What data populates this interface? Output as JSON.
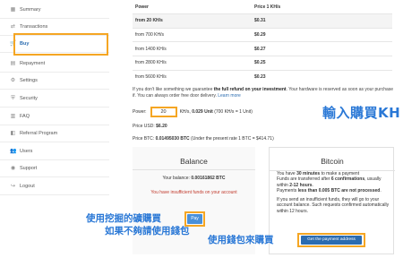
{
  "sidebar": {
    "items": [
      {
        "label": "Summary",
        "icon": "summary-icon",
        "glyph": "▦"
      },
      {
        "label": "Transactions",
        "icon": "transactions-icon",
        "glyph": "⇄"
      },
      {
        "label": "Buy",
        "icon": "cart-icon",
        "glyph": "🛒"
      },
      {
        "label": "Repayment",
        "icon": "repayment-icon",
        "glyph": "▤"
      },
      {
        "label": "Settings",
        "icon": "gear-icon",
        "glyph": "⚙"
      },
      {
        "label": "Security",
        "icon": "shield-icon",
        "glyph": "⛨"
      },
      {
        "label": "FAQ",
        "icon": "book-icon",
        "glyph": "▥"
      },
      {
        "label": "Referral Program",
        "icon": "referral-icon",
        "glyph": "◧"
      },
      {
        "label": "Users",
        "icon": "users-icon",
        "glyph": "👥"
      },
      {
        "label": "Support",
        "icon": "support-icon",
        "glyph": "◉"
      },
      {
        "label": "Logout",
        "icon": "logout-icon",
        "glyph": "↪"
      }
    ],
    "active": "Buy"
  },
  "price_table": {
    "col_power": "Power",
    "col_price": "Price 1 KH/s",
    "rows": [
      {
        "power": "from 20 KH/s",
        "price": "$0.31"
      },
      {
        "power": "from 700 KH/s",
        "price": "$0.29"
      },
      {
        "power": "from 1400 KH/s",
        "price": "$0.27"
      },
      {
        "power": "from 2800 KH/s",
        "price": "$0.25"
      },
      {
        "power": "from 5600 KH/s",
        "price": "$0.23"
      }
    ]
  },
  "note": {
    "pre": "If you don't like something we guarantee ",
    "bold": "the full refund on your investment",
    "post": ". Your hardware is reserved as soon as your purchase if. You can always order free door delivery. ",
    "link": "Learn more"
  },
  "power": {
    "label": "Power:",
    "value": "20",
    "unit": "KH/s,",
    "units": "0.029 Unit",
    "units_note": "(700 KH/s = 1 Unit)"
  },
  "usd": {
    "label": "Price USD:",
    "value": "$6.20"
  },
  "btc": {
    "label": "Price BTC:",
    "value": "0.01495030 BTC",
    "note": "(Under the present rate 1 BTC = $414.71)"
  },
  "annotations": {
    "big": "輸入購買KH",
    "pay_line1": "使用挖掘的礦購買",
    "pay_line2": "如果不夠請使用錢包",
    "wallet": "使用錢包來購買"
  },
  "balance_panel": {
    "title": "Balance",
    "balance_label": "Your balance:",
    "balance_value": "0.00161862 BTC",
    "warning": "You have insufficient funds on your account",
    "pay_button": "Pay"
  },
  "bitcoin_panel": {
    "title": "Bitcoin",
    "p1_a": "You have ",
    "p1_b": "30 minutes",
    "p1_c": " to make a payment",
    "p2_a": "Funds are transferred after ",
    "p2_b": "6 confirmations",
    "p2_c": ", usually within ",
    "p2_d": "2-12 hours",
    "p2_e": ".",
    "p3_a": "Payments ",
    "p3_b": "less than 0.005 BTC are not processed",
    "p3_c": ".",
    "p4": "If you send an insufficient funds, they will go to your account balance. Such requests confirmed automatically within 12 hours.",
    "button": "Get the payment address"
  },
  "colors": {
    "accent": "#2b6cb0",
    "highlight_border": "#f5a623",
    "annotation": "#2a78d6",
    "warning": "#c0392b"
  }
}
